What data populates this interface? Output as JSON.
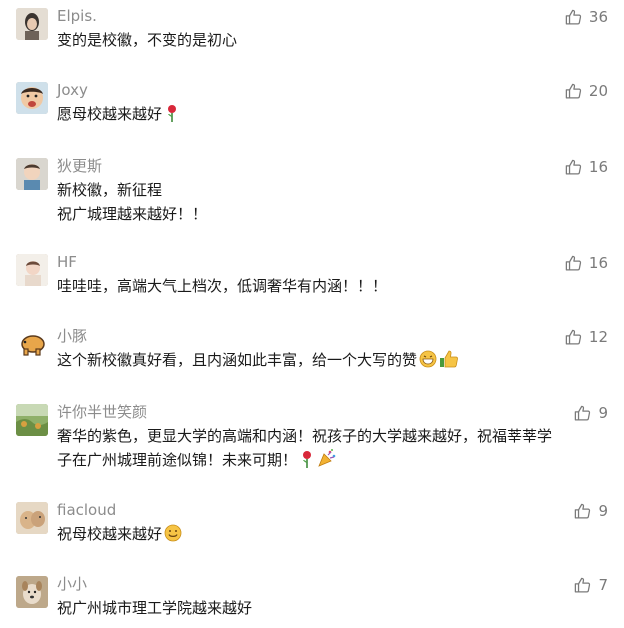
{
  "comments": [
    {
      "name": "Elpis.",
      "likes": "36",
      "lines": [
        "变的是校徽，不变的是初心"
      ],
      "emoji": ""
    },
    {
      "name": "Joxy",
      "likes": "20",
      "lines": [
        "愿母校越来越好"
      ],
      "emoji": "rose"
    },
    {
      "name": "狄更斯",
      "likes": "16",
      "lines": [
        "新校徽，新征程",
        "祝广城理越来越好！！"
      ],
      "emoji": ""
    },
    {
      "name": "HF",
      "likes": "16",
      "lines": [
        "哇哇哇，高端大气上档次，低调奢华有内涵！！！"
      ],
      "emoji": ""
    },
    {
      "name": "小豚",
      "likes": "12",
      "lines": [
        "这个新校徽真好看，且内涵如此丰富，给一个大写的赞"
      ],
      "emoji": "grin-thumb"
    },
    {
      "name": "许你半世笑颜",
      "likes": "9",
      "lines": [
        "奢华的紫色，更显大学的高端和内涵！祝孩子的大学越来越好，祝福莘莘学",
        "子在广州城理前途似锦！未来可期！"
      ],
      "emoji": "rose-party"
    },
    {
      "name": "fiacloud",
      "likes": "9",
      "lines": [
        "祝母校越来越好"
      ],
      "emoji": "smile"
    },
    {
      "name": "小小",
      "likes": "7",
      "lines": [
        "祝广州城市理工学院越来越好"
      ],
      "emoji": ""
    }
  ],
  "icons": {
    "like": "thumbs-up-outline-icon"
  }
}
